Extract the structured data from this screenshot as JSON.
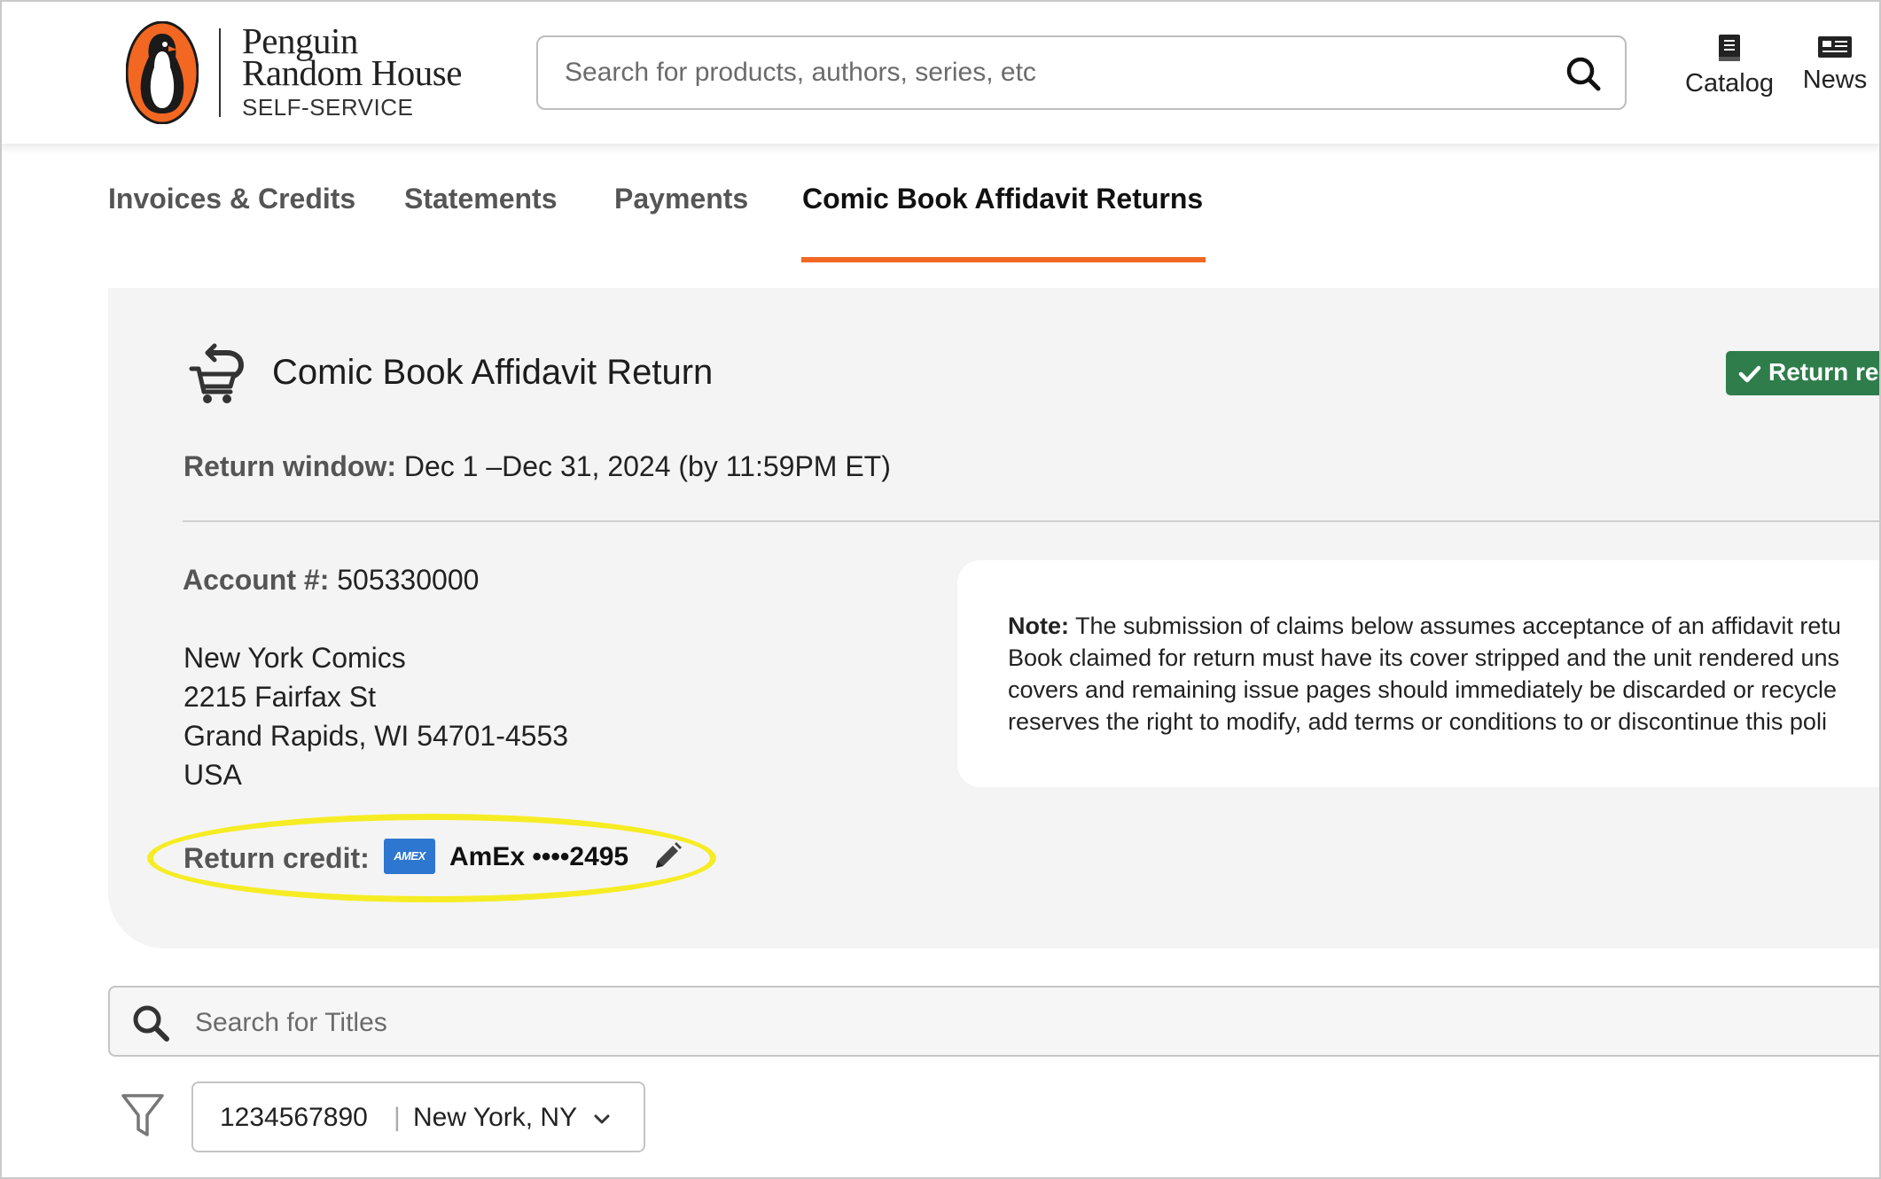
{
  "header": {
    "brand_line1": "Penguin",
    "brand_line2": "Random House",
    "brand_sub": "SELF-SERVICE",
    "search_placeholder": "Search for products, authors, series, etc",
    "nav": [
      {
        "label": "Catalog",
        "icon": "book-icon"
      },
      {
        "label": "News",
        "icon": "newspaper-icon"
      }
    ]
  },
  "tabs": [
    {
      "label": "Invoices & Credits",
      "active": false
    },
    {
      "label": "Statements",
      "active": false
    },
    {
      "label": "Payments",
      "active": false
    },
    {
      "label": "Comic Book Affidavit Returns",
      "active": true
    }
  ],
  "return_panel": {
    "title": "Comic Book Affidavit Return",
    "status_badge": "Return re",
    "window_label": "Return window:",
    "window_value": "Dec 1 –Dec 31, 2024 (by 11:59PM ET)",
    "account_label": "Account #:",
    "account_value": "505330000",
    "address": [
      "New York Comics",
      "2215 Fairfax St",
      "Grand Rapids, WI 54701-4553",
      "USA"
    ],
    "credit_label": "Return credit:",
    "card_brand_logo": "AMEX",
    "card_text": "AmEx ••••2495",
    "note_label": "Note:",
    "note_lines": [
      "The submission of claims below assumes acceptance of an affidavit retu",
      "Book claimed for return must have its cover stripped and the unit rendered uns",
      "covers and remaining issue pages should immediately be discarded or recycle",
      "reserves the right to modify, add terms or conditions to or discontinue this poli"
    ]
  },
  "title_search": {
    "placeholder": "Search for Titles"
  },
  "location_filter": {
    "account": "1234567890",
    "separator": "|",
    "city": "New York, NY"
  },
  "colors": {
    "accent_orange": "#f26722",
    "status_green": "#2e7d4a",
    "highlight_yellow": "#f6ec24",
    "amex_blue": "#2e77d0",
    "panel_bg": "#f4f4f4"
  }
}
